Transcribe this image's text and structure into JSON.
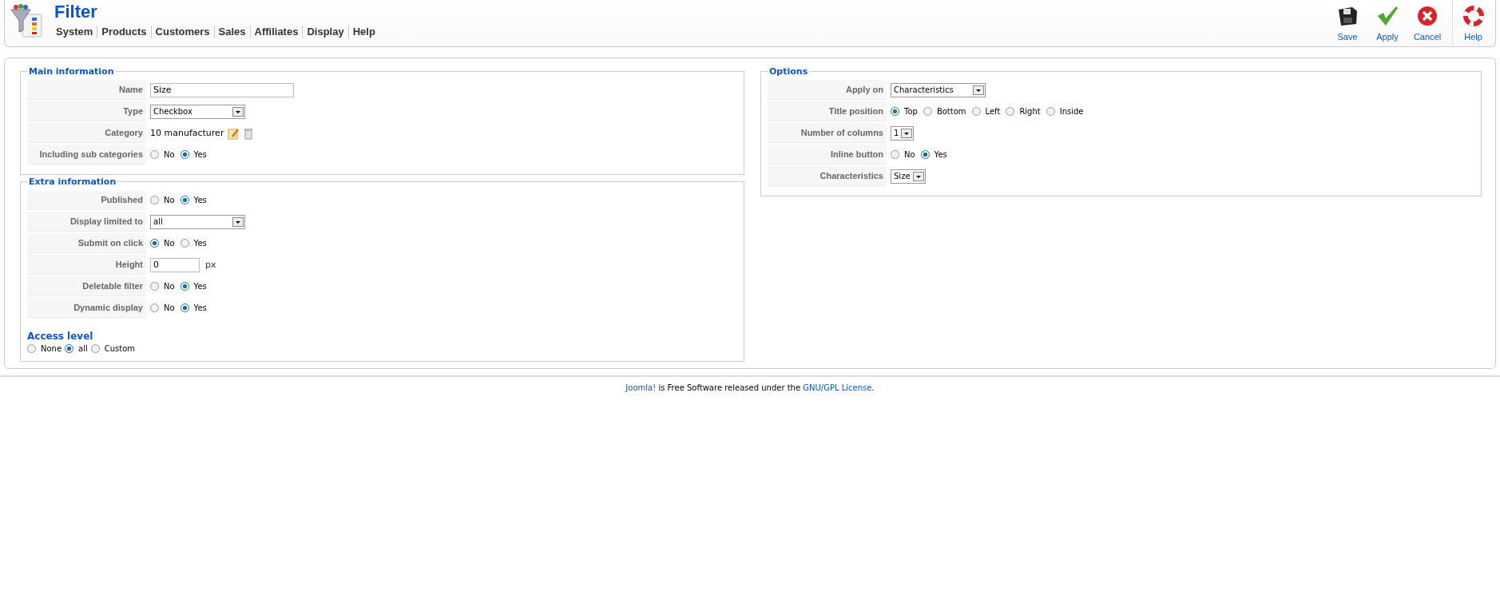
{
  "header": {
    "title": "Filter",
    "menu": [
      "System",
      "Products",
      "Customers",
      "Sales",
      "Affiliates",
      "Display",
      "Help"
    ],
    "toolbar": [
      {
        "kind": "save",
        "label": "Save"
      },
      {
        "kind": "apply",
        "label": "Apply"
      },
      {
        "kind": "cancel",
        "label": "Cancel"
      },
      {
        "kind": "help",
        "label": "Help"
      }
    ]
  },
  "left": [
    {
      "title": "Main information",
      "fields": [
        {
          "kind": "text",
          "label": "Name",
          "value": "Size"
        },
        {
          "kind": "select",
          "label": "Type",
          "value": "Checkbox"
        },
        {
          "kind": "category",
          "label": "Category",
          "value": "10 manufacturer"
        },
        {
          "kind": "radio",
          "label": "Including sub categories",
          "options": [
            {
              "label": "No",
              "selected": false
            },
            {
              "label": "Yes",
              "selected": true
            }
          ]
        }
      ]
    },
    {
      "title": "Extra information",
      "fields": [
        {
          "kind": "radio",
          "label": "Published",
          "options": [
            {
              "label": "No",
              "selected": false
            },
            {
              "label": "Yes",
              "selected": true
            }
          ]
        },
        {
          "kind": "select",
          "label": "Display limited to",
          "value": "all"
        },
        {
          "kind": "radio",
          "label": "Submit on click",
          "options": [
            {
              "label": "No",
              "selected": true
            },
            {
              "label": "Yes",
              "selected": false
            }
          ]
        },
        {
          "kind": "unit",
          "label": "Height",
          "value": "0",
          "unit": "px"
        },
        {
          "kind": "radio",
          "label": "Deletable filter",
          "options": [
            {
              "label": "No",
              "selected": false
            },
            {
              "label": "Yes",
              "selected": true
            }
          ]
        },
        {
          "kind": "radio",
          "label": "Dynamic display",
          "options": [
            {
              "label": "No",
              "selected": false
            },
            {
              "label": "Yes",
              "selected": true
            }
          ]
        }
      ],
      "access": {
        "title": "Access level",
        "options": [
          {
            "label": "None",
            "selected": false
          },
          {
            "label": "all",
            "selected": true
          },
          {
            "label": "Custom",
            "selected": false
          }
        ]
      }
    }
  ],
  "right": [
    {
      "title": "Options",
      "fields": [
        {
          "kind": "select",
          "label": "Apply on",
          "value": "Characteristics"
        },
        {
          "kind": "radio",
          "label": "Title position",
          "options": [
            {
              "label": "Top",
              "selected": true
            },
            {
              "label": "Bottom",
              "selected": false
            },
            {
              "label": "Left",
              "selected": false
            },
            {
              "label": "Right",
              "selected": false
            },
            {
              "label": "Inside",
              "selected": false
            }
          ]
        },
        {
          "kind": "select",
          "label": "Number of columns",
          "value": "1"
        },
        {
          "kind": "radio",
          "label": "Inline button",
          "options": [
            {
              "label": "No",
              "selected": false
            },
            {
              "label": "Yes",
              "selected": true
            }
          ]
        },
        {
          "kind": "select",
          "label": "Characteristics",
          "value": "Size"
        }
      ]
    }
  ],
  "footer": [
    {
      "kind": "link",
      "text": "Joomla!"
    },
    {
      "kind": "text",
      "text": "is Free Software released under the"
    },
    {
      "kind": "link",
      "text": "GNU/GPL License"
    },
    {
      "kind": "text",
      "text": "."
    }
  ]
}
